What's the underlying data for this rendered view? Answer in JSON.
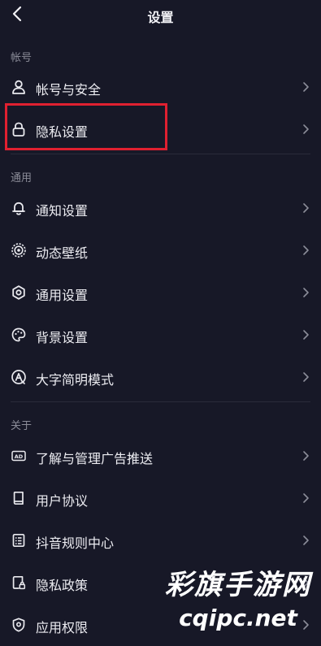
{
  "header": {
    "title": "设置",
    "back_icon": "chevron-left-icon"
  },
  "sections": {
    "account": {
      "label": "帐号",
      "items": [
        {
          "label": "帐号与安全",
          "icon": "person-icon"
        },
        {
          "label": "隐私设置",
          "icon": "lock-icon",
          "highlighted": true
        }
      ]
    },
    "general": {
      "label": "通用",
      "items": [
        {
          "label": "通知设置",
          "icon": "bell-icon"
        },
        {
          "label": "动态壁纸",
          "icon": "wallpaper-icon"
        },
        {
          "label": "通用设置",
          "icon": "gear-icon"
        },
        {
          "label": "背景设置",
          "icon": "palette-icon"
        },
        {
          "label": "大字简明模式",
          "icon": "large-text-icon"
        }
      ]
    },
    "about": {
      "label": "关于",
      "items": [
        {
          "label": "了解与管理广告推送",
          "icon": "ad-icon"
        },
        {
          "label": "用户协议",
          "icon": "book-icon"
        },
        {
          "label": "抖音规则中心",
          "icon": "rules-icon"
        },
        {
          "label": "隐私政策",
          "icon": "privacy-doc-icon"
        },
        {
          "label": "应用权限",
          "icon": "shield-icon"
        }
      ]
    }
  },
  "watermark": {
    "line1": "彩旗手游网",
    "line2": "cqipc.net"
  },
  "colors": {
    "background": "#171827",
    "highlight_border": "#e02030",
    "section_label": "#8b8c98"
  }
}
